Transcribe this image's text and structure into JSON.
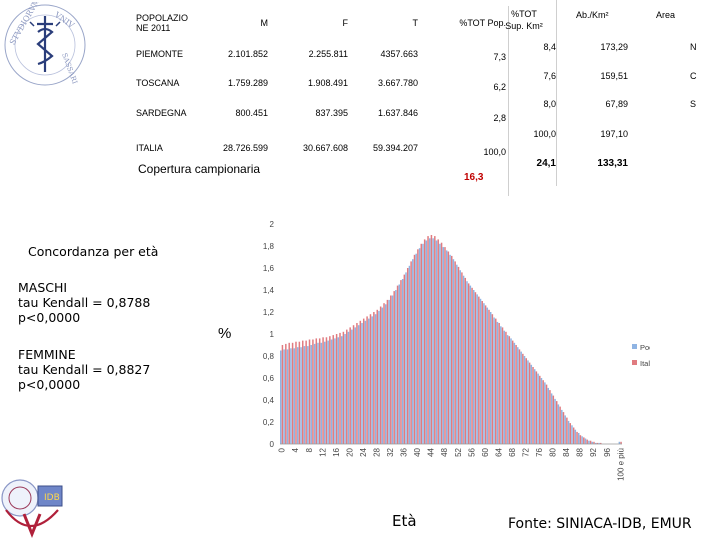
{
  "table": {
    "headers": [
      "POPOLAZIONE 2011",
      "M",
      "F",
      "T",
      "%TOT Pop."
    ],
    "header_line1": "POPOLAZIO",
    "header_line2": "NE 2011",
    "rows": [
      {
        "name": "PIEMONTE",
        "m": "2.101.852",
        "f": "2.255.811",
        "t": "4357.663",
        "pct": "7,3"
      },
      {
        "name": "TOSCANA",
        "m": "1.759.289",
        "f": "1.908.491",
        "t": "3.667.780",
        "pct": "6,2"
      },
      {
        "name": "SARDEGNA",
        "m": "800.451",
        "f": "837.395",
        "t": "1.637.846",
        "pct": "2,8"
      },
      {
        "name": "ITALIA",
        "m": "28.726.599",
        "f": "30.667.608",
        "t": "59.394.207",
        "pct": "100,0"
      }
    ]
  },
  "right_table": {
    "header_pct": "%TOT",
    "header_pct2": "Sup. Km²",
    "header_dens": "Ab./Km²",
    "header_area": "Area",
    "rows": [
      {
        "sup": "8,4",
        "dens": "173,29",
        "area": "N"
      },
      {
        "sup": "7,6",
        "dens": "159,51",
        "area": "C"
      },
      {
        "sup": "8,0",
        "dens": "67,89",
        "area": "S"
      },
      {
        "sup": "100,0",
        "dens": "197,10",
        "area": ""
      },
      {
        "sup": "24,1",
        "dens": "133,31",
        "area": ""
      }
    ]
  },
  "coverage": {
    "label": "Copertura campionaria",
    "value": "16,3"
  },
  "captions": {
    "concordanza": "Concordanza per età",
    "maschi": [
      "MASCHI",
      "tau Kendall = 0,8788",
      "p<0,0000"
    ],
    "femmine": [
      "FEMMINE",
      "tau Kendall = 0,8827",
      "p<0,0000"
    ],
    "pct_axis": "%",
    "eta": "Età",
    "fonte": "Fonte: SINIACA-IDB, EMUR"
  },
  "colors": {
    "pool": "#8fb4e3",
    "italia": "#e07b80",
    "coverage": "#c00000"
  },
  "chart_data": {
    "type": "bar",
    "ylim": [
      0,
      2
    ],
    "yticks": [
      "0",
      "0,2",
      "0,4",
      "0,6",
      "0,8",
      "1",
      "1,2",
      "1,4",
      "1,6",
      "1,8",
      "2"
    ],
    "xticks": [
      "0",
      "4",
      "8",
      "12",
      "16",
      "20",
      "24",
      "28",
      "32",
      "36",
      "40",
      "44",
      "48",
      "52",
      "56",
      "60",
      "64",
      "68",
      "72",
      "76",
      "80",
      "84",
      "88",
      "92",
      "96",
      "100 e più"
    ],
    "series": [
      {
        "name": "Pool 3 Reg.",
        "values": [
          0.85,
          0.86,
          0.86,
          0.87,
          0.87,
          0.88,
          0.88,
          0.89,
          0.89,
          0.9,
          0.91,
          0.92,
          0.92,
          0.93,
          0.94,
          0.95,
          0.96,
          0.97,
          0.98,
          1.0,
          1.02,
          1.04,
          1.06,
          1.08,
          1.1,
          1.12,
          1.14,
          1.16,
          1.18,
          1.21,
          1.24,
          1.27,
          1.31,
          1.35,
          1.4,
          1.45,
          1.5,
          1.56,
          1.62,
          1.68,
          1.73,
          1.78,
          1.82,
          1.85,
          1.87,
          1.87,
          1.85,
          1.82,
          1.79,
          1.76,
          1.72,
          1.68,
          1.63,
          1.58,
          1.53,
          1.48,
          1.44,
          1.4,
          1.36,
          1.32,
          1.28,
          1.24,
          1.2,
          1.15,
          1.11,
          1.07,
          1.03,
          0.99,
          0.96,
          0.92,
          0.88,
          0.84,
          0.8,
          0.76,
          0.72,
          0.68,
          0.64,
          0.6,
          0.56,
          0.51,
          0.46,
          0.41,
          0.36,
          0.31,
          0.26,
          0.21,
          0.17,
          0.13,
          0.1,
          0.07,
          0.05,
          0.03,
          0.02,
          0.01,
          0.01,
          0.0,
          0.0,
          0.0,
          0.0,
          0.0,
          0.02
        ]
      },
      {
        "name": "Italia",
        "values": [
          0.9,
          0.91,
          0.92,
          0.92,
          0.93,
          0.93,
          0.94,
          0.94,
          0.95,
          0.95,
          0.96,
          0.96,
          0.97,
          0.97,
          0.98,
          0.99,
          1.0,
          1.01,
          1.02,
          1.04,
          1.06,
          1.08,
          1.1,
          1.12,
          1.14,
          1.16,
          1.18,
          1.2,
          1.22,
          1.25,
          1.28,
          1.31,
          1.35,
          1.39,
          1.44,
          1.49,
          1.54,
          1.6,
          1.66,
          1.72,
          1.77,
          1.82,
          1.86,
          1.89,
          1.9,
          1.89,
          1.86,
          1.83,
          1.79,
          1.75,
          1.71,
          1.66,
          1.61,
          1.56,
          1.51,
          1.46,
          1.42,
          1.38,
          1.34,
          1.3,
          1.26,
          1.22,
          1.18,
          1.14,
          1.1,
          1.06,
          1.02,
          0.98,
          0.94,
          0.9,
          0.86,
          0.82,
          0.78,
          0.74,
          0.7,
          0.66,
          0.62,
          0.58,
          0.54,
          0.49,
          0.44,
          0.39,
          0.34,
          0.29,
          0.24,
          0.19,
          0.15,
          0.11,
          0.08,
          0.06,
          0.04,
          0.03,
          0.02,
          0.01,
          0.01,
          0.0,
          0.0,
          0.0,
          0.0,
          0.0,
          0.02
        ]
      }
    ],
    "legend_position": "right",
    "grid": false
  }
}
